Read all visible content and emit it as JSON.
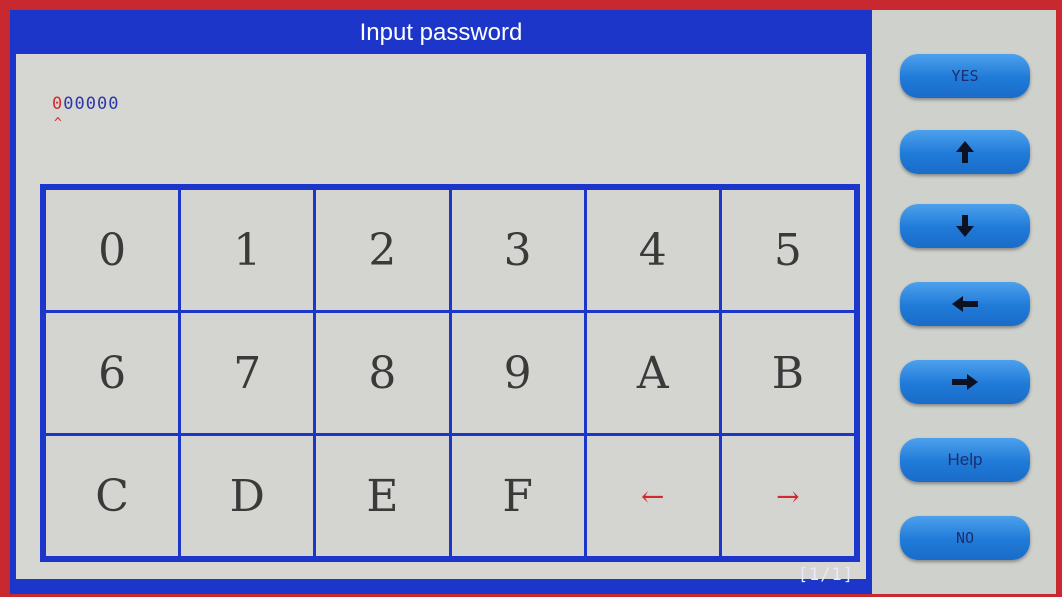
{
  "title": "Input password",
  "password": {
    "first_char": "0",
    "rest": "00000",
    "cursor": "^"
  },
  "keypad": {
    "keys": [
      "0",
      "1",
      "2",
      "3",
      "4",
      "5",
      "6",
      "7",
      "8",
      "9",
      "A",
      "B",
      "C",
      "D",
      "E",
      "F",
      "←",
      "→"
    ]
  },
  "page_indicator": "[1/1]",
  "side_buttons": {
    "yes": "YES",
    "up_icon": "arrow-up-icon",
    "down_icon": "arrow-down-icon",
    "left_icon": "arrow-left-icon",
    "right_icon": "arrow-right-icon",
    "help": "Help",
    "no": "NO"
  },
  "colors": {
    "bezel": "#c82830",
    "frame_blue": "#1b36c9",
    "content_gray": "#d6d7d3",
    "button_blue": "#1f7ad8",
    "accent_red": "#d3282d"
  }
}
